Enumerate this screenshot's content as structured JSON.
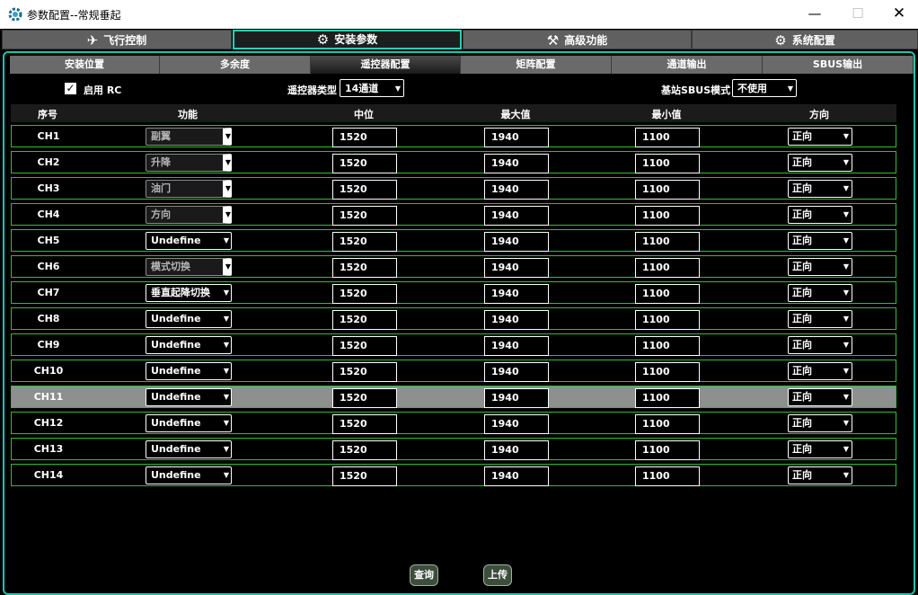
{
  "window": {
    "title": "参数配置--常规垂起",
    "app_icon": "gear-icon"
  },
  "main_tabs": [
    {
      "label": "飞行控制",
      "icon": "drone-icon"
    },
    {
      "label": "安装参数",
      "icon": "wrench-circle-icon",
      "active": true
    },
    {
      "label": "高级功能",
      "icon": "tools-icon"
    },
    {
      "label": "系统配置",
      "icon": "gear-icon"
    }
  ],
  "sub_tabs": [
    {
      "label": "安装位置"
    },
    {
      "label": "多余度"
    },
    {
      "label": "遥控器配置",
      "active": true
    },
    {
      "label": "矩阵配置"
    },
    {
      "label": "通道输出"
    },
    {
      "label": "SBUS输出"
    }
  ],
  "options": {
    "enable_rc": {
      "label": "启用 RC",
      "checked": true
    },
    "rc_type": {
      "label": "遥控器类型",
      "value": "14通道"
    },
    "sbus_mode": {
      "label": "基站SBUS模式",
      "value": "不使用"
    }
  },
  "table": {
    "headers": [
      "序号",
      "功能",
      "中位",
      "最大值",
      "最小值",
      "方向"
    ],
    "rows": [
      {
        "ch": "CH1",
        "func": "副翼",
        "func_enabled": false,
        "mid": "1520",
        "max": "1940",
        "min": "1100",
        "dir": "正向"
      },
      {
        "ch": "CH2",
        "func": "升降",
        "func_enabled": false,
        "mid": "1520",
        "max": "1940",
        "min": "1100",
        "dir": "正向"
      },
      {
        "ch": "CH3",
        "func": "油门",
        "func_enabled": false,
        "mid": "1520",
        "max": "1940",
        "min": "1100",
        "dir": "正向"
      },
      {
        "ch": "CH4",
        "func": "方向",
        "func_enabled": false,
        "mid": "1520",
        "max": "1940",
        "min": "1100",
        "dir": "正向"
      },
      {
        "ch": "CH5",
        "func": "Undefine",
        "func_enabled": true,
        "mid": "1520",
        "max": "1940",
        "min": "1100",
        "dir": "正向"
      },
      {
        "ch": "CH6",
        "func": "模式切换",
        "func_enabled": false,
        "mid": "1520",
        "max": "1940",
        "min": "1100",
        "dir": "正向"
      },
      {
        "ch": "CH7",
        "func": "垂直起降切换",
        "func_enabled": true,
        "mid": "1520",
        "max": "1940",
        "min": "1100",
        "dir": "正向"
      },
      {
        "ch": "CH8",
        "func": "Undefine",
        "func_enabled": true,
        "mid": "1520",
        "max": "1940",
        "min": "1100",
        "dir": "正向"
      },
      {
        "ch": "CH9",
        "func": "Undefine",
        "func_enabled": true,
        "mid": "1520",
        "max": "1940",
        "min": "1100",
        "dir": "正向"
      },
      {
        "ch": "CH10",
        "func": "Undefine",
        "func_enabled": true,
        "mid": "1520",
        "max": "1940",
        "min": "1100",
        "dir": "正向"
      },
      {
        "ch": "CH11",
        "func": "Undefine",
        "func_enabled": true,
        "mid": "1520",
        "max": "1940",
        "min": "1100",
        "dir": "正向",
        "selected": true
      },
      {
        "ch": "CH12",
        "func": "Undefine",
        "func_enabled": true,
        "mid": "1520",
        "max": "1940",
        "min": "1100",
        "dir": "正向"
      },
      {
        "ch": "CH13",
        "func": "Undefine",
        "func_enabled": true,
        "mid": "1520",
        "max": "1940",
        "min": "1100",
        "dir": "正向"
      },
      {
        "ch": "CH14",
        "func": "Undefine",
        "func_enabled": true,
        "mid": "1520",
        "max": "1940",
        "min": "1100",
        "dir": "正向"
      }
    ]
  },
  "buttons": {
    "query": "查询",
    "upload": "上传"
  },
  "colors": {
    "accent": "#17c7b0",
    "row_border": "#2fbf2f",
    "selected_row": "#8f8f8f"
  }
}
